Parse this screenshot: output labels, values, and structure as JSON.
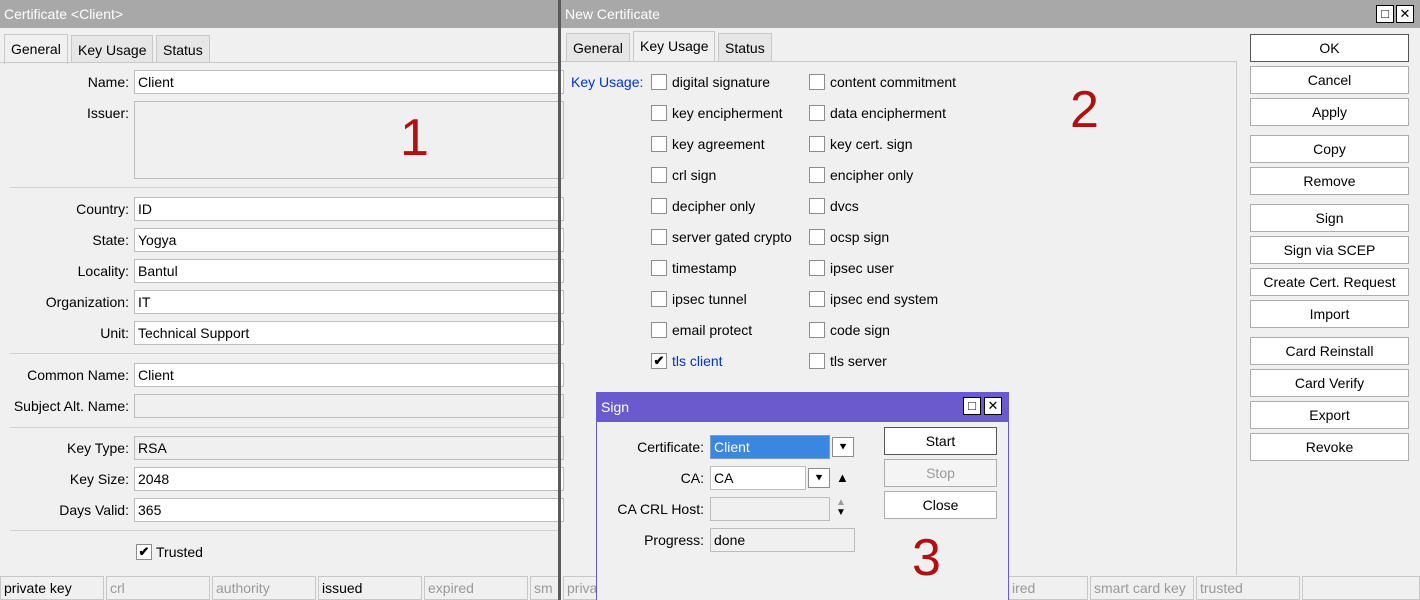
{
  "left_window": {
    "title": "Certificate <Client>",
    "tabs": [
      "General",
      "Key Usage",
      "Status"
    ],
    "fields": {
      "name": {
        "label": "Name:",
        "value": "Client"
      },
      "issuer": {
        "label": "Issuer:",
        "value": ""
      },
      "country": {
        "label": "Country:",
        "value": "ID"
      },
      "state": {
        "label": "State:",
        "value": "Yogya"
      },
      "locality": {
        "label": "Locality:",
        "value": "Bantul"
      },
      "organization": {
        "label": "Organization:",
        "value": "IT"
      },
      "unit": {
        "label": "Unit:",
        "value": "Technical Support"
      },
      "common_name": {
        "label": "Common Name:",
        "value": "Client"
      },
      "subject_alt_name": {
        "label": "Subject Alt. Name:",
        "value": ""
      },
      "key_type": {
        "label": "Key Type:",
        "value": "RSA"
      },
      "key_size": {
        "label": "Key Size:",
        "value": "2048"
      },
      "days_valid": {
        "label": "Days Valid:",
        "value": "365"
      }
    },
    "trusted_label": "Trusted",
    "trusted_checked": true,
    "annotation": "1",
    "status_bar": [
      "private key",
      "crl",
      "authority",
      "issued",
      "expired",
      "sm"
    ]
  },
  "right_window": {
    "title": "New Certificate",
    "tabs": [
      "General",
      "Key Usage",
      "Status"
    ],
    "key_usage_label": "Key Usage:",
    "key_usage_col1": [
      {
        "label": "digital signature",
        "checked": false
      },
      {
        "label": "key encipherment",
        "checked": false
      },
      {
        "label": "key agreement",
        "checked": false
      },
      {
        "label": "crl sign",
        "checked": false
      },
      {
        "label": "decipher only",
        "checked": false
      },
      {
        "label": "server gated crypto",
        "checked": false
      },
      {
        "label": "timestamp",
        "checked": false
      },
      {
        "label": "ipsec tunnel",
        "checked": false
      },
      {
        "label": "email protect",
        "checked": false
      },
      {
        "label": "tls client",
        "checked": true
      }
    ],
    "key_usage_col2": [
      {
        "label": "content commitment",
        "checked": false
      },
      {
        "label": "data encipherment",
        "checked": false
      },
      {
        "label": "key cert. sign",
        "checked": false
      },
      {
        "label": "encipher only",
        "checked": false
      },
      {
        "label": "dvcs",
        "checked": false
      },
      {
        "label": "ocsp sign",
        "checked": false
      },
      {
        "label": "ipsec user",
        "checked": false
      },
      {
        "label": "ipsec end system",
        "checked": false
      },
      {
        "label": "code sign",
        "checked": false
      },
      {
        "label": "tls server",
        "checked": false
      }
    ],
    "annotation": "2",
    "buttons": [
      "OK",
      "Cancel",
      "Apply",
      "Copy",
      "Remove",
      "Sign",
      "Sign via SCEP",
      "Create Cert. Request",
      "Import",
      "Card Reinstall",
      "Card Verify",
      "Export",
      "Revoke"
    ],
    "status_bar": [
      "priva",
      "ired",
      "smart card key",
      "trusted",
      ""
    ]
  },
  "sign_dialog": {
    "title": "Sign",
    "certificate_label": "Certificate:",
    "certificate_value": "Client",
    "ca_label": "CA:",
    "ca_value": "CA",
    "crl_host_label": "CA CRL Host:",
    "crl_host_value": "",
    "progress_label": "Progress:",
    "progress_value": "done",
    "start_label": "Start",
    "stop_label": "Stop",
    "close_label": "Close",
    "annotation": "3"
  },
  "colors": {
    "accent_blue": "#0033cc",
    "annotation_red": "#b01010",
    "dialog_title": "#6a5acd"
  }
}
